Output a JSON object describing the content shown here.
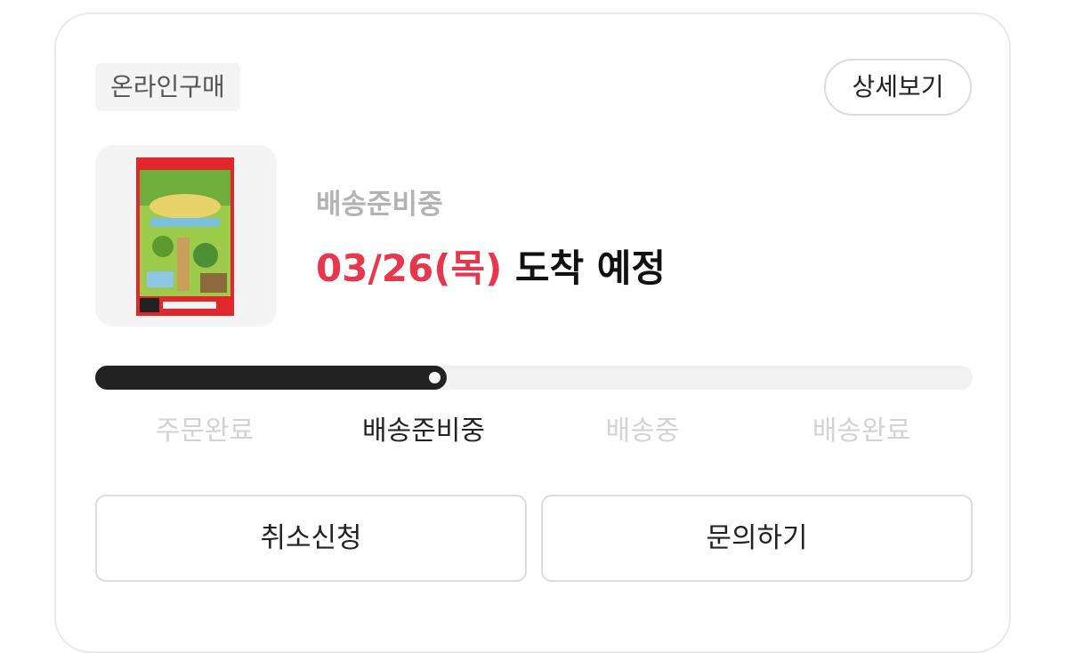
{
  "order": {
    "channel_badge": "온라인구매",
    "detail_button": "상세보기",
    "status_label": "배송준비중",
    "eta_date": "03/26(목)",
    "eta_suffix": " 도착 예정"
  },
  "progress": {
    "fraction": 0.395,
    "steps": [
      {
        "label": "주문완료",
        "active": false
      },
      {
        "label": "배송준비중",
        "active": true
      },
      {
        "label": "배송중",
        "active": false
      },
      {
        "label": "배송완료",
        "active": false
      }
    ]
  },
  "actions": {
    "cancel_label": "취소신청",
    "inquiry_label": "문의하기"
  },
  "colors": {
    "accent": "#e8374c",
    "progress_fill": "#222222",
    "progress_track": "#f1f1f1",
    "inactive_text": "#d3d3d3"
  }
}
